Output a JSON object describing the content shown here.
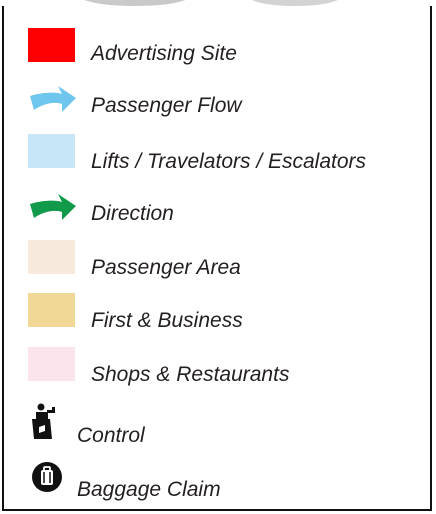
{
  "legend": {
    "items": [
      {
        "label": "Advertising Site",
        "kind": "swatch",
        "color": "#ff0000"
      },
      {
        "label": "Passenger Flow",
        "kind": "arrow",
        "color": "#6ec6ef",
        "icon": "arrow-icon"
      },
      {
        "label": "Lifts / Travelators / Escalators",
        "kind": "swatch",
        "color": "#c7e7f8"
      },
      {
        "label": "Direction",
        "kind": "arrow",
        "color": "#109a4a",
        "icon": "arrow-icon"
      },
      {
        "label": "Passenger Area",
        "kind": "swatch",
        "color": "#f7e9dc"
      },
      {
        "label": "First & Business",
        "kind": "swatch",
        "color": "#f2d896"
      },
      {
        "label": "Shops & Restaurants",
        "kind": "swatch",
        "color": "#fbe4ec"
      },
      {
        "label": "Control",
        "kind": "icon",
        "icon": "security-control-icon"
      },
      {
        "label": "Baggage Claim",
        "kind": "icon",
        "icon": "baggage-claim-icon"
      }
    ]
  }
}
